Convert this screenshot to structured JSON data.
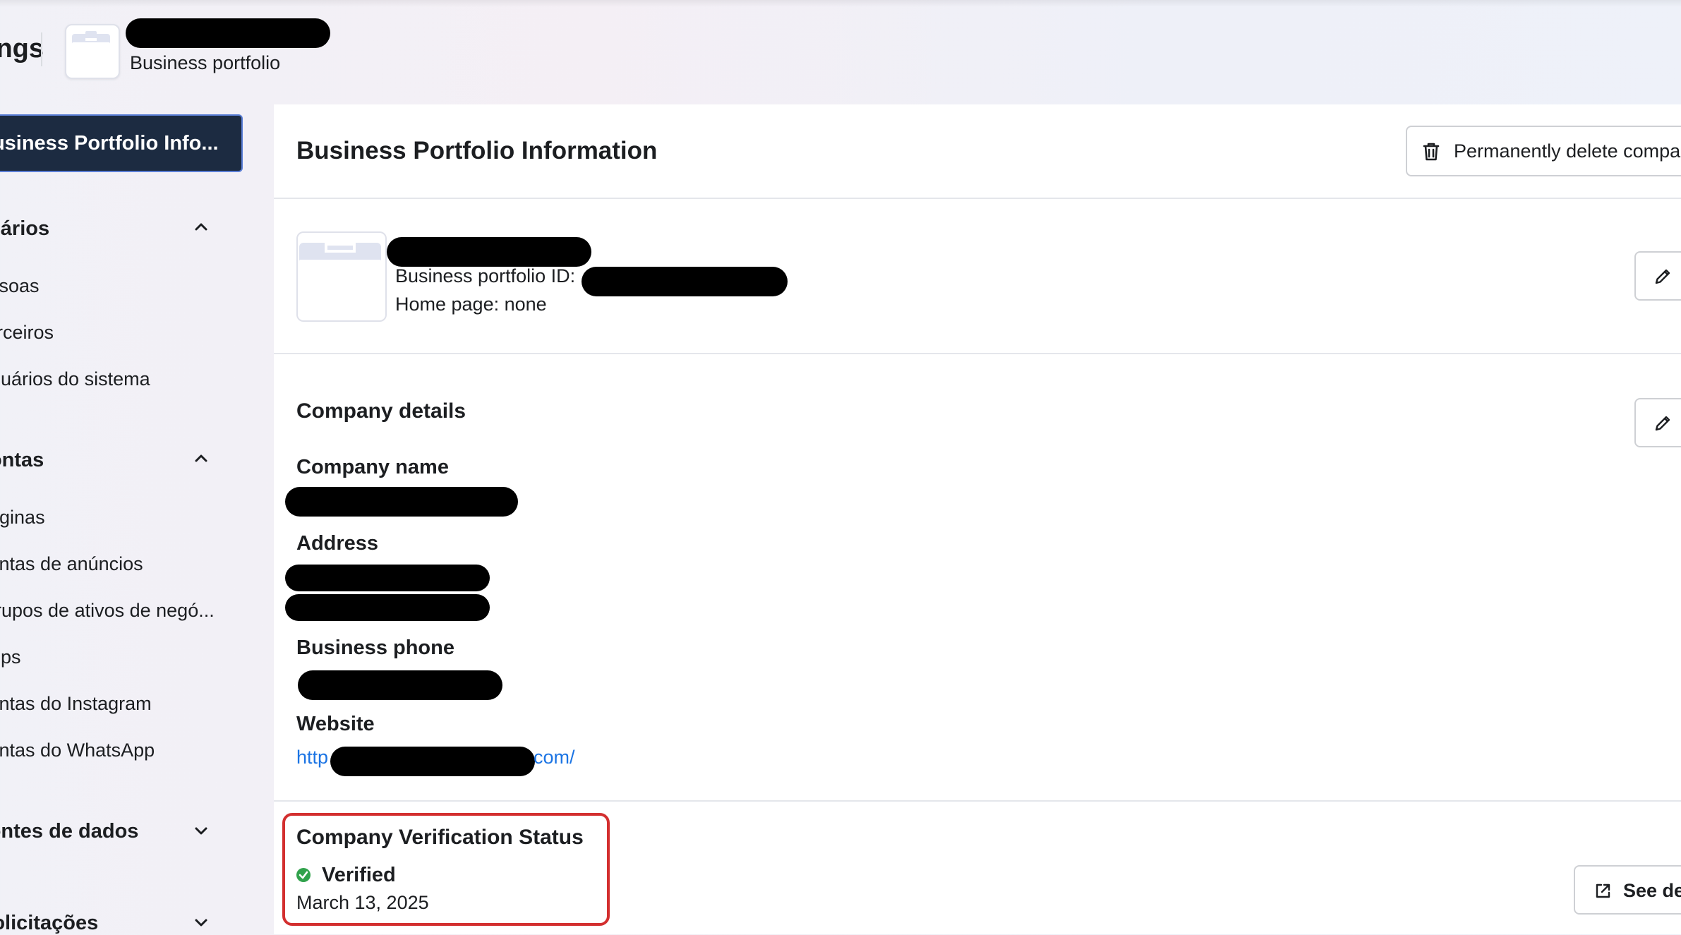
{
  "header": {
    "app_title": "Business Settings",
    "portfolio_type": "Business portfolio"
  },
  "sidebar": {
    "active_item": "Business Portfolio Info...",
    "sections": [
      {
        "title": "Usuários",
        "expanded": true,
        "items": [
          "Pessoas",
          "Parceiros",
          "Usuários do sistema"
        ]
      },
      {
        "title": "Contas",
        "expanded": true,
        "items": [
          "Páginas",
          "Contas de anúncios",
          "Grupos de ativos de negó...",
          "Apps",
          "Contas do Instagram",
          "Contas do WhatsApp"
        ]
      },
      {
        "title": "Fontes de dados",
        "expanded": false,
        "items": []
      },
      {
        "title": "Solicitações",
        "expanded": false,
        "items": []
      }
    ]
  },
  "main": {
    "title": "Business Portfolio Information",
    "delete_button": "Permanently delete company",
    "portfolio": {
      "id_label": "Business portfolio ID:",
      "home_page": "Home page: none"
    },
    "company_details": {
      "title": "Company details",
      "company_name_label": "Company name",
      "address_label": "Address",
      "business_phone_label": "Business phone",
      "website_label": "Website",
      "website_prefix": "http",
      "website_suffix": "com/"
    },
    "verification": {
      "title": "Company Verification Status",
      "status": "Verified",
      "date": "March 13, 2025",
      "see_details_button": "See details",
      "status_color": "#31a24c",
      "highlight_color": "#d32f2f"
    }
  },
  "icons": [
    "briefcase-icon",
    "chevron-up-icon",
    "chevron-down-icon",
    "trash-icon",
    "pencil-icon",
    "external-link-icon"
  ]
}
